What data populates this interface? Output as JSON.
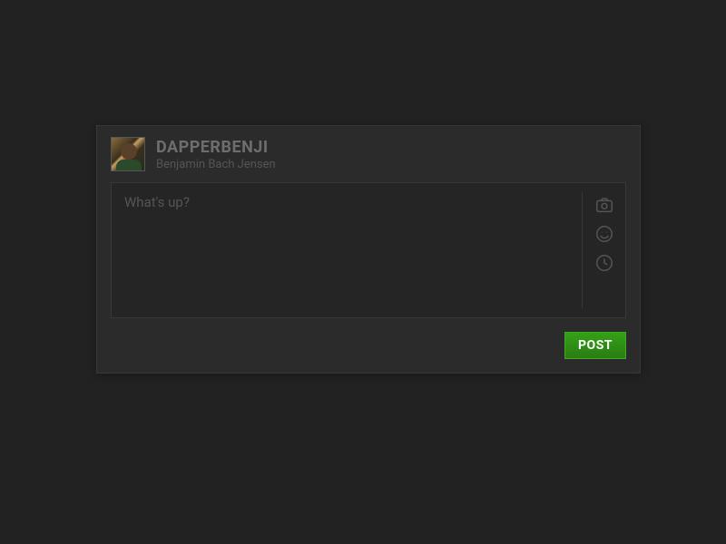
{
  "user": {
    "username": "DAPPERBENJI",
    "realname": "Benjamin Bach Jensen"
  },
  "compose": {
    "placeholder": "What's up?"
  },
  "actions": {
    "post_label": "POST"
  },
  "icons": {
    "camera": "camera-icon",
    "emoji": "emoji-icon",
    "schedule": "clock-icon"
  },
  "colors": {
    "background": "#222222",
    "card": "#2b2b2b",
    "compose_bg": "#252525",
    "border": "#383838",
    "text_muted": "#555555",
    "text_dim": "#6e6e6e",
    "button_bg": "#2e8a18",
    "button_text": "#ffffff"
  }
}
